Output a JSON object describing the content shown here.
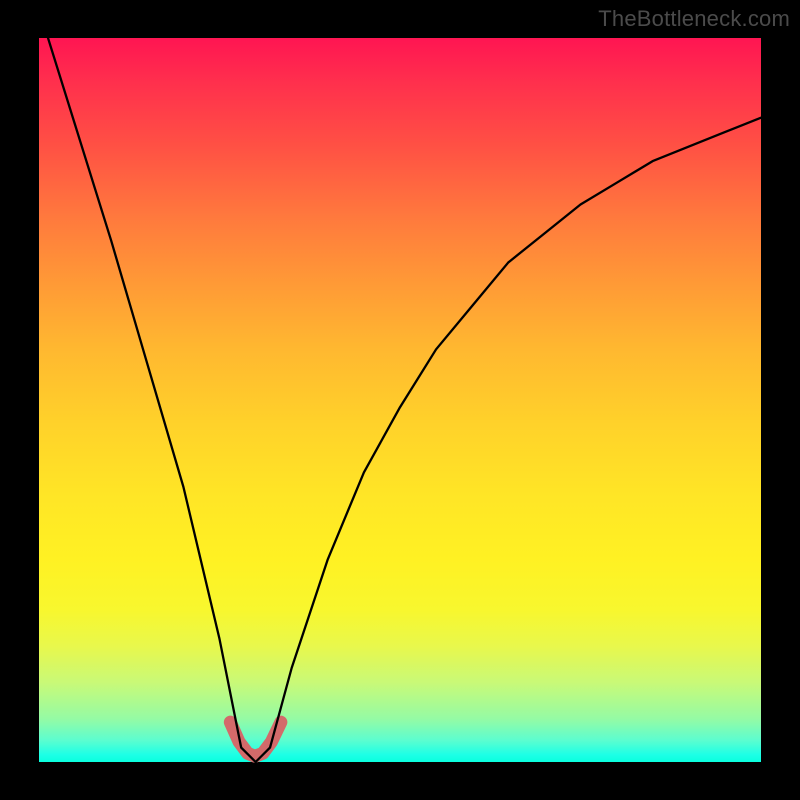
{
  "watermark": "TheBottleneck.com",
  "chart_data": {
    "type": "line",
    "title": "",
    "xlabel": "",
    "ylabel": "",
    "xlim": [
      0,
      1
    ],
    "ylim": [
      0,
      1
    ],
    "series": [
      {
        "name": "bottleneck-curve",
        "x": [
          0.0,
          0.05,
          0.1,
          0.15,
          0.2,
          0.25,
          0.28,
          0.3,
          0.32,
          0.35,
          0.4,
          0.45,
          0.5,
          0.55,
          0.6,
          0.65,
          0.7,
          0.75,
          0.8,
          0.85,
          0.9,
          0.95,
          1.0
        ],
        "y": [
          1.04,
          0.88,
          0.72,
          0.55,
          0.38,
          0.17,
          0.02,
          0.0,
          0.02,
          0.13,
          0.28,
          0.4,
          0.49,
          0.57,
          0.63,
          0.69,
          0.73,
          0.77,
          0.8,
          0.83,
          0.85,
          0.87,
          0.89
        ]
      },
      {
        "name": "cusp-marker",
        "x": [
          0.265,
          0.277,
          0.289,
          0.299,
          0.31,
          0.322,
          0.335
        ],
        "y": [
          0.055,
          0.028,
          0.012,
          0.008,
          0.012,
          0.028,
          0.055
        ]
      }
    ],
    "colors": {
      "curve": "#000000",
      "cusp": "#d36a6a",
      "background_top": "#ff1552",
      "background_bottom": "#09ffde"
    }
  }
}
